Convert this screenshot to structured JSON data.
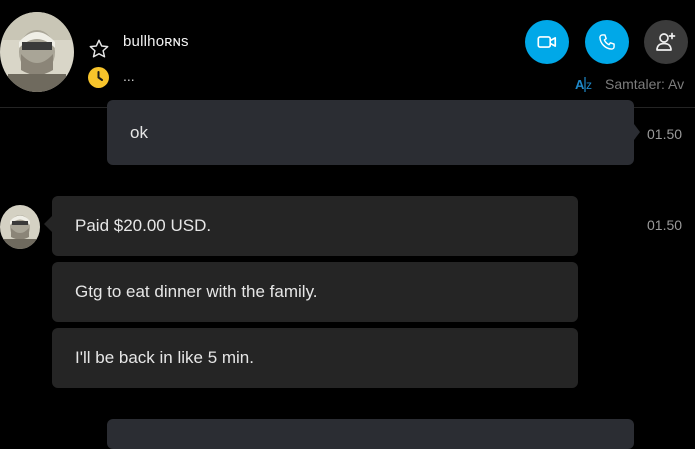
{
  "contact": {
    "name": "bullhorns",
    "name_display": "bullhoʀɴs",
    "status_text": "..."
  },
  "header": {
    "translate_label": "Samtaler: Av"
  },
  "messages": [
    {
      "direction": "out",
      "text": "ok",
      "time": "01.50"
    },
    {
      "direction": "in",
      "text": "Paid $20.00 USD.",
      "time": "01.50"
    },
    {
      "direction": "in",
      "text": "Gtg to eat dinner with the family.",
      "time": ""
    },
    {
      "direction": "in",
      "text": "I'll be back in like 5 min.",
      "time": ""
    }
  ],
  "colors": {
    "accent": "#00a8e8",
    "status_away": "#f7c42b",
    "background": "#000000"
  },
  "icons": {
    "video": "video-camera-icon",
    "call": "phone-icon",
    "add_person": "add-person-icon",
    "favorite": "star-icon",
    "status": "clock-icon",
    "translate": "translate-icon"
  }
}
